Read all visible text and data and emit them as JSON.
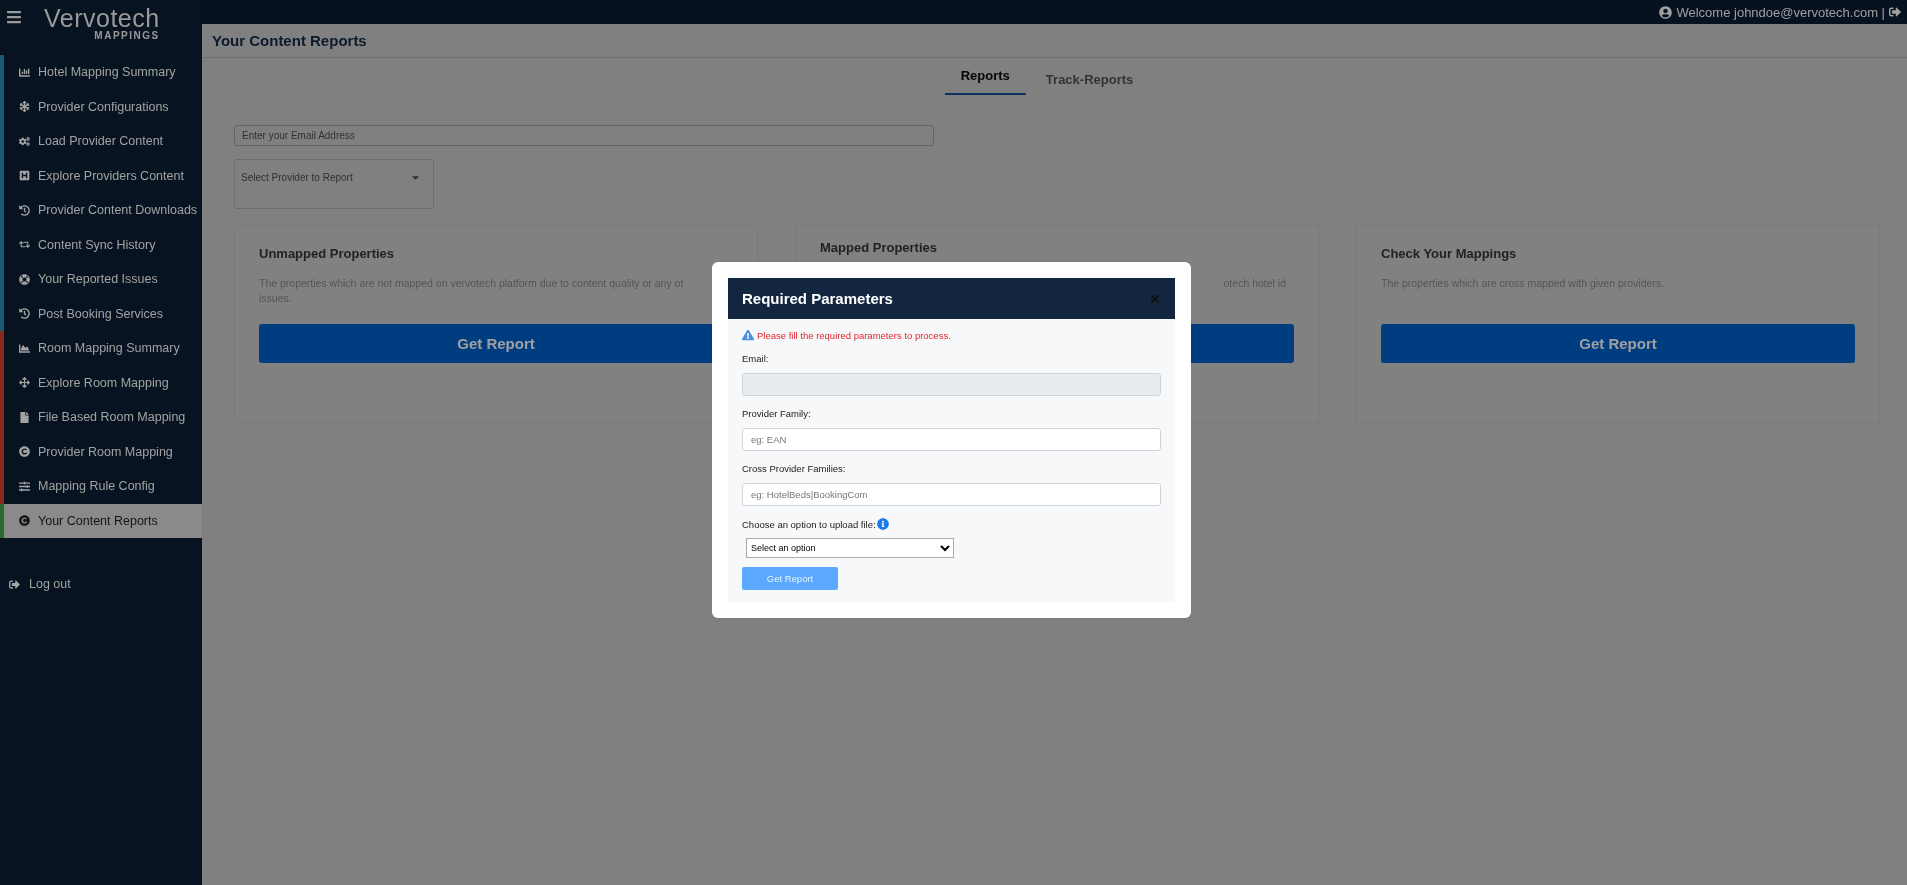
{
  "header": {
    "logo": {
      "name": "Vervotech",
      "tagline": "MAPPINGS"
    },
    "welcome": "Welcome johndoe@vervotech.com |"
  },
  "sidebar": {
    "items": [
      {
        "label": "Hotel Mapping Summary",
        "color": "#1b5a73",
        "selected": false
      },
      {
        "label": "Provider Configurations",
        "color": "#1b5a73",
        "selected": false
      },
      {
        "label": "Load Provider Content",
        "color": "#1b5a73",
        "selected": false
      },
      {
        "label": "Explore Providers Content",
        "color": "#1b5a73",
        "selected": false
      },
      {
        "label": "Provider Content Downloads",
        "color": "#1b5a73",
        "selected": false
      },
      {
        "label": "Content Sync History",
        "color": "#1b5a73",
        "selected": false
      },
      {
        "label": "Your Reported Issues",
        "color": "#1b5a73",
        "selected": false
      },
      {
        "label": "Post Booking Services",
        "color": "#1b5a73",
        "selected": false
      },
      {
        "label": "Room Mapping Summary",
        "color": "#8a2a1a",
        "selected": false
      },
      {
        "label": "Explore Room Mapping",
        "color": "#8a2a1a",
        "selected": false
      },
      {
        "label": "File Based Room Mapping",
        "color": "#8a2a1a",
        "selected": false
      },
      {
        "label": "Provider Room Mapping",
        "color": "#8a2a1a",
        "selected": false
      },
      {
        "label": "Mapping Rule Config",
        "color": "#8a2a1a",
        "selected": false
      },
      {
        "label": "Your Content Reports",
        "color": "#2d6a2d",
        "selected": true
      }
    ],
    "logout": "Log out"
  },
  "page": {
    "title": "Your Content Reports",
    "tabs": [
      {
        "label": "Reports",
        "selected": true
      },
      {
        "label": "Track-Reports",
        "selected": false
      }
    ],
    "email_field": {
      "placeholder": "Enter your Email Address"
    },
    "provider_select": {
      "placeholder": "Select Provider to Report"
    },
    "cards": [
      {
        "kind": "full",
        "title": "Unmapped Properties",
        "description_lines": [
          "The properties which are not mapped on vervotech platform due to content quality or any ot",
          "issues."
        ],
        "button": "Get Report"
      },
      {
        "kind": "covered",
        "title": "Mapped Properties",
        "description_lines": [
          "otech hotel id"
        ]
      },
      {
        "kind": "full",
        "title": "Check Your Mappings",
        "description_lines": [
          "The properties which are cross mapped with given providers."
        ],
        "button": "Get Report"
      }
    ]
  },
  "modal": {
    "title": "Required Parameters",
    "warning": "Please fill the required parameters to process.",
    "fields": [
      {
        "label": "Email:",
        "disabled": true
      },
      {
        "label": "Provider Family:",
        "placeholder": "eg: EAN",
        "disabled": false
      },
      {
        "label": "Cross Provider Families:",
        "placeholder": "eg: HotelBeds|BookingCom",
        "disabled": false
      }
    ],
    "upload": {
      "label": "Choose an option to upload file:",
      "option": "Select an option"
    },
    "button": "Get Report"
  }
}
